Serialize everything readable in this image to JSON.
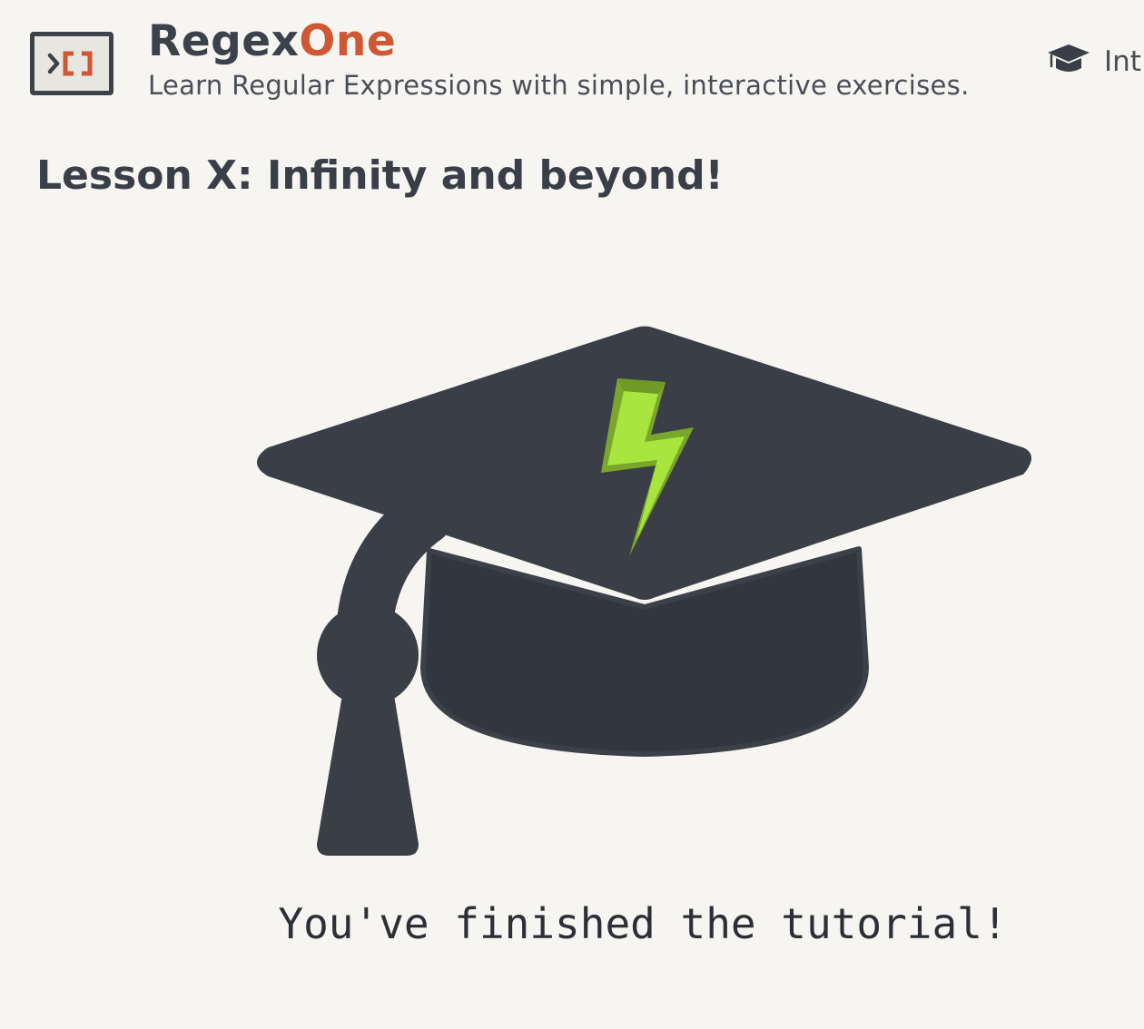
{
  "header": {
    "brand_part1": "Regex",
    "brand_part2": "One",
    "tagline": "Learn Regular Expressions with simple, interactive exercises.",
    "nav_link_label": "Int"
  },
  "lesson": {
    "title": "Lesson X: Infinity and beyond!",
    "illustration_icon": "graduation-cap-with-lightning-bolt",
    "message": "You've finished the tutorial!"
  },
  "colors": {
    "background": "#f6f5f1",
    "dark": "#3a3e47",
    "brand_accent": "#cf5733",
    "bolt_green": "#a8e63f",
    "bolt_green_dark": "#7aa62c"
  }
}
